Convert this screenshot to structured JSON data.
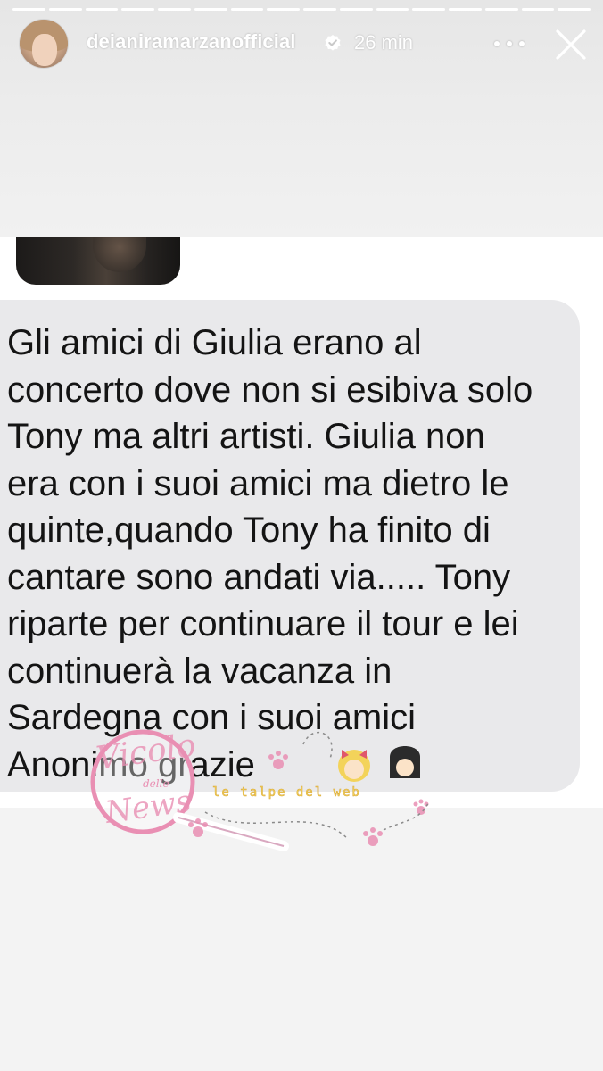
{
  "story": {
    "username": "deianiramarzanofficial",
    "time_ago": "26 min",
    "progress": {
      "total_segments": 16,
      "completed_segments": 16
    }
  },
  "icons": {
    "verified": "verified-badge-icon",
    "more": "more-options-icon",
    "close": "close-icon"
  },
  "message": {
    "text": "Gli amici di Giulia erano al\nconcerto dove non si esibiva solo\nTony ma altri artisti. Giulia non\nera con i suoi amici ma dietro le\nquinte,quando Tony ha finito di\ncantare sono andati via..... Tony\nriparte per continuare il tour e lei\ncontinuerà la vacanza in\nSardegna con i suoi amici\nAnonimo grazie"
  },
  "watermark": {
    "line1": "Vicolo",
    "line2": "delle",
    "line3": "News",
    "line4": "le talpe del web"
  },
  "colors": {
    "bubble": "#e9e9eb",
    "text": "#141414",
    "watermark_pink": "#e98fb3",
    "watermark_yellow": "#f3d35a"
  }
}
